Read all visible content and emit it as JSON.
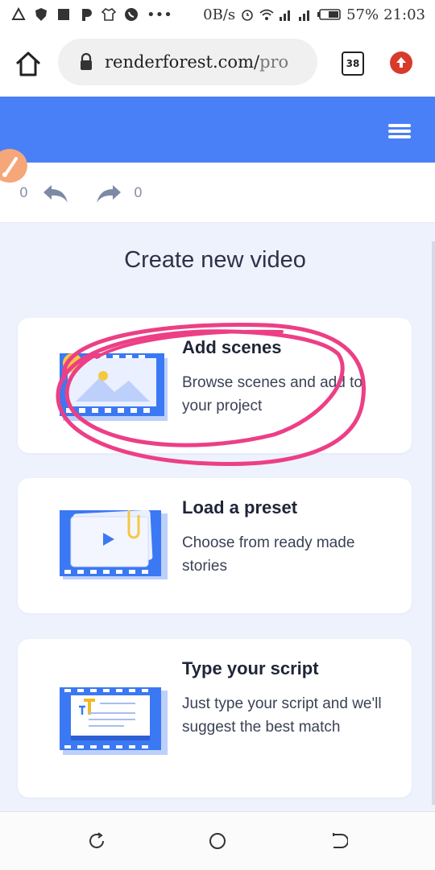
{
  "status_bar": {
    "data_rate": "0B/s",
    "battery": "57%",
    "time": "21:03"
  },
  "browser": {
    "url_domain": "renderforest.com/",
    "url_path": "pro",
    "tab_count": "38",
    "icons": [
      "home-icon",
      "lock-icon",
      "tabs-icon",
      "update-icon"
    ]
  },
  "toolbar": {
    "undo_count": "0",
    "redo_count": "0"
  },
  "main": {
    "title": "Create new video",
    "cards": [
      {
        "title": "Add scenes",
        "description": "Browse scenes and add to your project",
        "icon": "scene-film-icon"
      },
      {
        "title": "Load a preset",
        "description": "Choose from ready made stories",
        "icon": "preset-play-icon"
      },
      {
        "title": "Type your script",
        "description": "Just type your script and we'll suggest the best match",
        "icon": "script-text-icon"
      }
    ]
  },
  "colors": {
    "header_blue": "#4a80f7",
    "main_bg": "#eef2fd",
    "annotation_pink": "#ec3f86"
  }
}
